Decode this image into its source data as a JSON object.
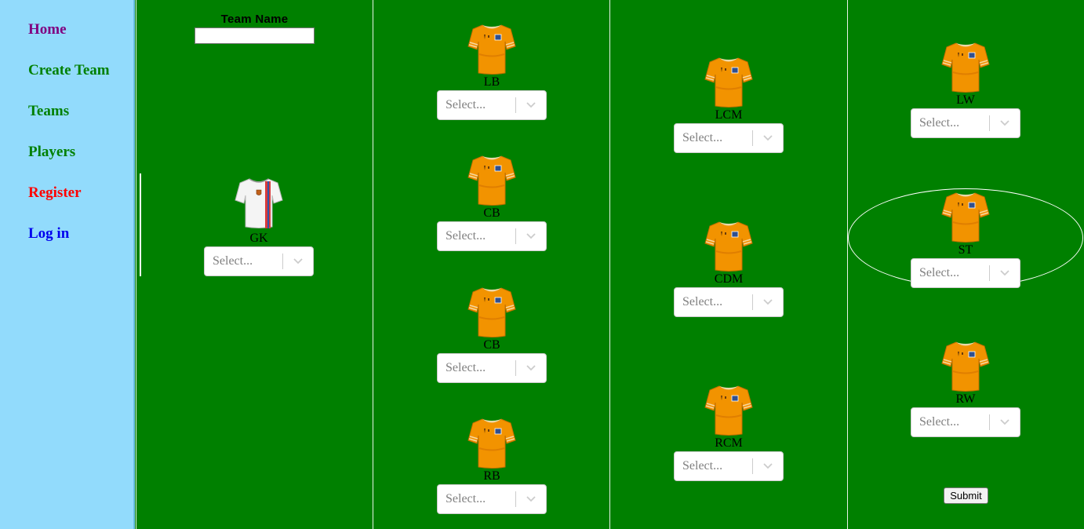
{
  "nav": {
    "items": [
      {
        "label": "Home",
        "color": "#800080"
      },
      {
        "label": "Create Team",
        "color": "#008000"
      },
      {
        "label": "Teams",
        "color": "#008000"
      },
      {
        "label": "Players",
        "color": "#008000"
      },
      {
        "label": "Register",
        "color": "#ff0000"
      },
      {
        "label": "Log in",
        "color": "#0000ee"
      }
    ]
  },
  "team": {
    "name_label": "Team Name",
    "name_value": ""
  },
  "select_placeholder": "Select...",
  "positions": {
    "gk": "GK",
    "lb": "LB",
    "cb1": "CB",
    "cb2": "CB",
    "rb": "RB",
    "lcm": "LCM",
    "cdm": "CDM",
    "rcm": "RCM",
    "lw": "LW",
    "st": "ST",
    "rw": "RW"
  },
  "submit_label": "Submit",
  "colors": {
    "sidebar_bg": "#92dbfc",
    "pitch": "#008000",
    "jersey_orange": "#f39200",
    "gk_jersey": "#ffffff"
  }
}
